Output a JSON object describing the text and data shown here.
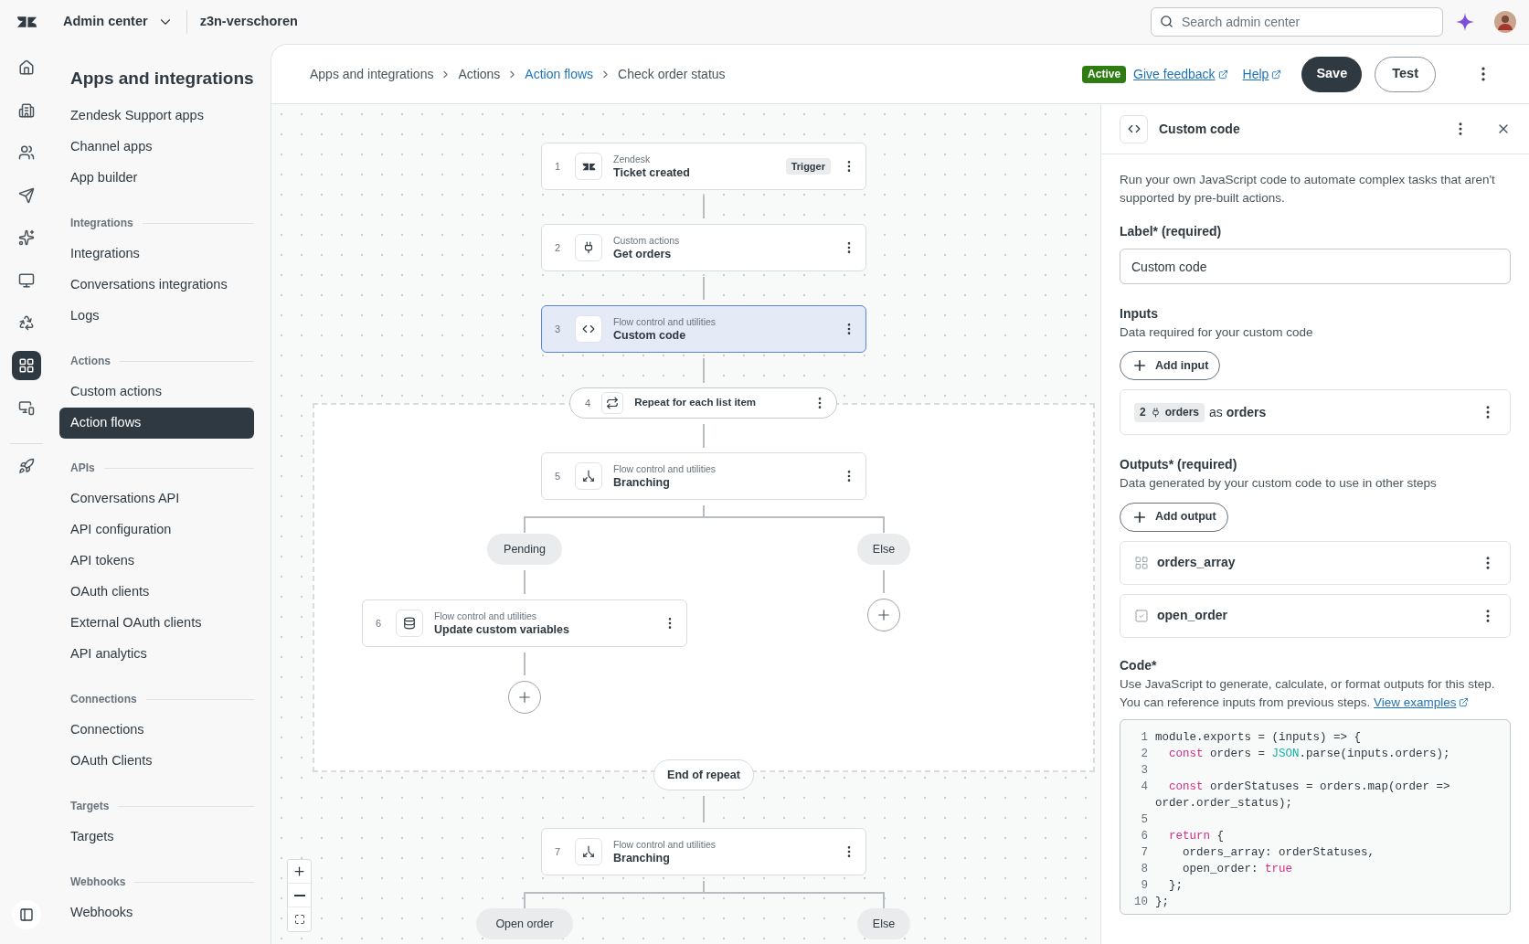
{
  "top_bar": {
    "product": "Admin center",
    "account": "z3n-verschoren",
    "search": {
      "placeholder": "Search admin center"
    }
  },
  "rail": [
    {
      "kind": "home",
      "selected": false
    },
    {
      "kind": "building",
      "selected": false
    },
    {
      "kind": "people",
      "selected": false
    },
    {
      "kind": "send",
      "selected": false
    },
    {
      "kind": "sparkle",
      "selected": false
    },
    {
      "kind": "monitor",
      "selected": false
    },
    {
      "kind": "recycle",
      "selected": false
    },
    {
      "kind": "apps",
      "selected": true
    },
    {
      "kind": "devices",
      "selected": false
    },
    {
      "kind": "rocket",
      "selected": false
    }
  ],
  "sidebar": {
    "title": "Apps and integrations",
    "sections": [
      {
        "items": [
          {
            "label": "Zendesk Support apps",
            "selected": false
          },
          {
            "label": "Channel apps",
            "selected": false
          },
          {
            "label": "App builder",
            "selected": false
          }
        ]
      },
      {
        "heading": "Integrations",
        "items": [
          {
            "label": "Integrations",
            "selected": false
          },
          {
            "label": "Conversations integrations",
            "selected": false
          },
          {
            "label": "Logs",
            "selected": false
          }
        ]
      },
      {
        "heading": "Actions",
        "items": [
          {
            "label": "Custom actions",
            "selected": false
          },
          {
            "label": "Action flows",
            "selected": true
          }
        ]
      },
      {
        "heading": "APIs",
        "items": [
          {
            "label": "Conversations API",
            "selected": false
          },
          {
            "label": "API configuration",
            "selected": false
          },
          {
            "label": "API tokens",
            "selected": false
          },
          {
            "label": "OAuth clients",
            "selected": false
          },
          {
            "label": "External OAuth clients",
            "selected": false
          },
          {
            "label": "API analytics",
            "selected": false
          }
        ]
      },
      {
        "heading": "Connections",
        "items": [
          {
            "label": "Connections",
            "selected": false
          },
          {
            "label": "OAuth Clients",
            "selected": false
          }
        ]
      },
      {
        "heading": "Targets",
        "items": [
          {
            "label": "Targets",
            "selected": false
          }
        ]
      },
      {
        "heading": "Webhooks",
        "items": [
          {
            "label": "Webhooks",
            "selected": false
          }
        ]
      }
    ]
  },
  "breadcrumb": [
    {
      "label": "Apps and integrations",
      "link": false
    },
    {
      "label": "Actions",
      "link": false
    },
    {
      "label": "Action flows",
      "link": true
    },
    {
      "label": "Check order status",
      "link": false
    }
  ],
  "header": {
    "status": "Active",
    "links": [
      "Give feedback",
      "Help"
    ],
    "buttons": [
      {
        "label": "Save",
        "kind": "primary"
      },
      {
        "label": "Test",
        "kind": "secondary"
      }
    ]
  },
  "canvas": {
    "steps": [
      {
        "kind": "trigger",
        "number": "1",
        "category": "Zendesk",
        "title": "Ticket created",
        "badge": "Trigger",
        "selected": false
      },
      {
        "kind": "custom_action",
        "number": "2",
        "category": "Custom actions",
        "title": "Get orders",
        "selected": false
      },
      {
        "kind": "code",
        "number": "3",
        "category": "Flow control and utilities",
        "title": "Custom code",
        "selected": true
      },
      {
        "kind": "loop",
        "number": "4",
        "title": "Repeat for each list item",
        "selected": false
      },
      {
        "kind": "branching",
        "number": "5",
        "category": "Flow control and utilities",
        "title": "Branching",
        "selected": false
      },
      {
        "kind": "variables",
        "number": "6",
        "category": "Flow control and utilities",
        "title": "Update custom variables",
        "selected": false
      },
      {
        "kind": "branching",
        "number": "7",
        "category": "Flow control and utilities",
        "title": "Branching",
        "selected": false
      }
    ],
    "branch_labels": [
      "Pending",
      "Else",
      "Open order",
      "Else"
    ],
    "loop_end": "End of repeat"
  },
  "panel": {
    "title": "Custom code",
    "description": "Run your own JavaScript code to automate complex tasks that aren't supported by pre-built actions.",
    "label_field": {
      "label": "Label* (required)",
      "value": "Custom code"
    },
    "inputs": {
      "heading": "Inputs",
      "hint": "Data required for your custom code",
      "add_button": "Add input",
      "items": [
        {
          "step": "2",
          "source": "orders",
          "connector": "as",
          "alias": "orders"
        }
      ]
    },
    "outputs": {
      "heading": "Outputs* (required)",
      "hint": "Data generated by your custom code to use in other steps",
      "add_button": "Add output",
      "items": [
        {
          "name": "orders_array",
          "kind": "array"
        },
        {
          "name": "open_order",
          "kind": "boolean"
        }
      ]
    },
    "code": {
      "heading": "Code*",
      "hint": "Use JavaScript to generate, calculate, or format outputs for this step. You can reference inputs from previous steps.",
      "link": "View examples",
      "lines": [
        {
          "number": "1",
          "tokens": [
            {
              "text": "module.exports = (inputs) => {",
              "kind": "plain"
            }
          ]
        },
        {
          "number": "2",
          "tokens": [
            {
              "text": "  const",
              "kind": "keyword"
            },
            {
              "text": " orders = ",
              "kind": "plain"
            },
            {
              "text": "JSON",
              "kind": "builtin"
            },
            {
              "text": ".parse(inputs.orders);",
              "kind": "plain"
            }
          ]
        },
        {
          "number": "3"
        },
        {
          "number": "4",
          "tokens": [
            {
              "text": "  const",
              "kind": "keyword"
            },
            {
              "text": " orderStatuses = orders.map(order => order.order_status);",
              "kind": "plain"
            }
          ]
        },
        {
          "number": "5"
        },
        {
          "number": "6",
          "tokens": [
            {
              "text": "  return",
              "kind": "keyword"
            },
            {
              "text": " {",
              "kind": "plain"
            }
          ]
        },
        {
          "number": "7",
          "tokens": [
            {
              "text": "    orders_array: orderStatuses,",
              "kind": "plain"
            }
          ]
        },
        {
          "number": "8",
          "tokens": [
            {
              "text": "    open_order: ",
              "kind": "plain"
            },
            {
              "text": "true",
              "kind": "keyword"
            }
          ]
        },
        {
          "number": "9",
          "tokens": [
            {
              "text": "  };",
              "kind": "plain"
            }
          ]
        },
        {
          "number": "10",
          "tokens": [
            {
              "text": "};",
              "kind": "plain"
            }
          ]
        }
      ]
    }
  }
}
